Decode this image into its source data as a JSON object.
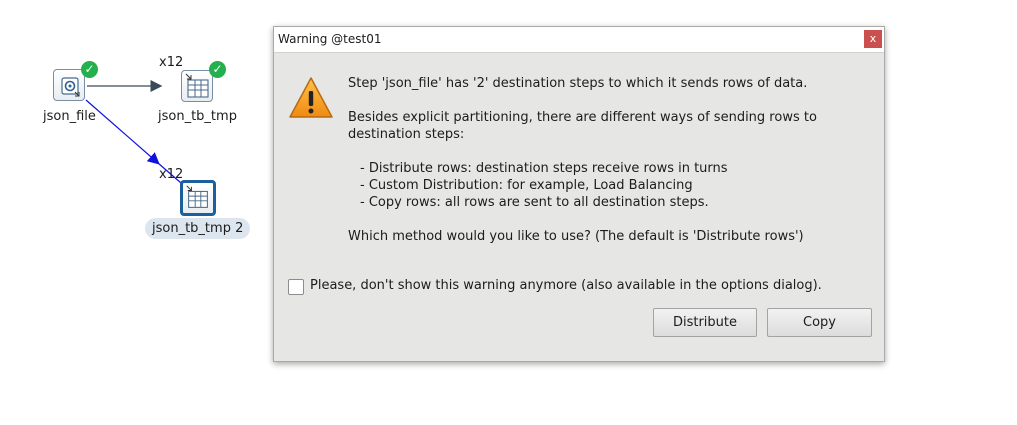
{
  "canvas": {
    "steps": [
      {
        "label": "json_file",
        "status": "check-icon"
      },
      {
        "label": "json_tb_tmp",
        "copies": "x12",
        "status": "check-icon"
      },
      {
        "label": "json_tb_tmp 2",
        "copies": "x12",
        "selected": true
      }
    ]
  },
  "dialog": {
    "title": "Warning @test01",
    "close_label": "x",
    "message_line1": "Step 'json_file' has '2' destination steps to which it sends rows of data.",
    "message_para2_line1": "Besides explicit partitioning, there are different ways of sending rows to",
    "message_para2_line2": "destination steps:",
    "options": [
      "- Distribute rows: destination steps receive rows in turns",
      "- Custom Distribution: for example,  Load Balancing",
      "- Copy rows: all rows are sent to all destination steps."
    ],
    "question": "Which method would you like to use? (The default is 'Distribute rows')",
    "checkbox_label": "Please, don't show this warning anymore (also available in the options dialog).",
    "checkbox_checked": false,
    "buttons": {
      "distribute": "Distribute",
      "copy": "Copy"
    }
  },
  "colors": {
    "hop_normal": "#3a4a5a",
    "hop_selected": "#1010e0",
    "ok_badge": "#22b14c",
    "warning": "#f29b1d"
  }
}
